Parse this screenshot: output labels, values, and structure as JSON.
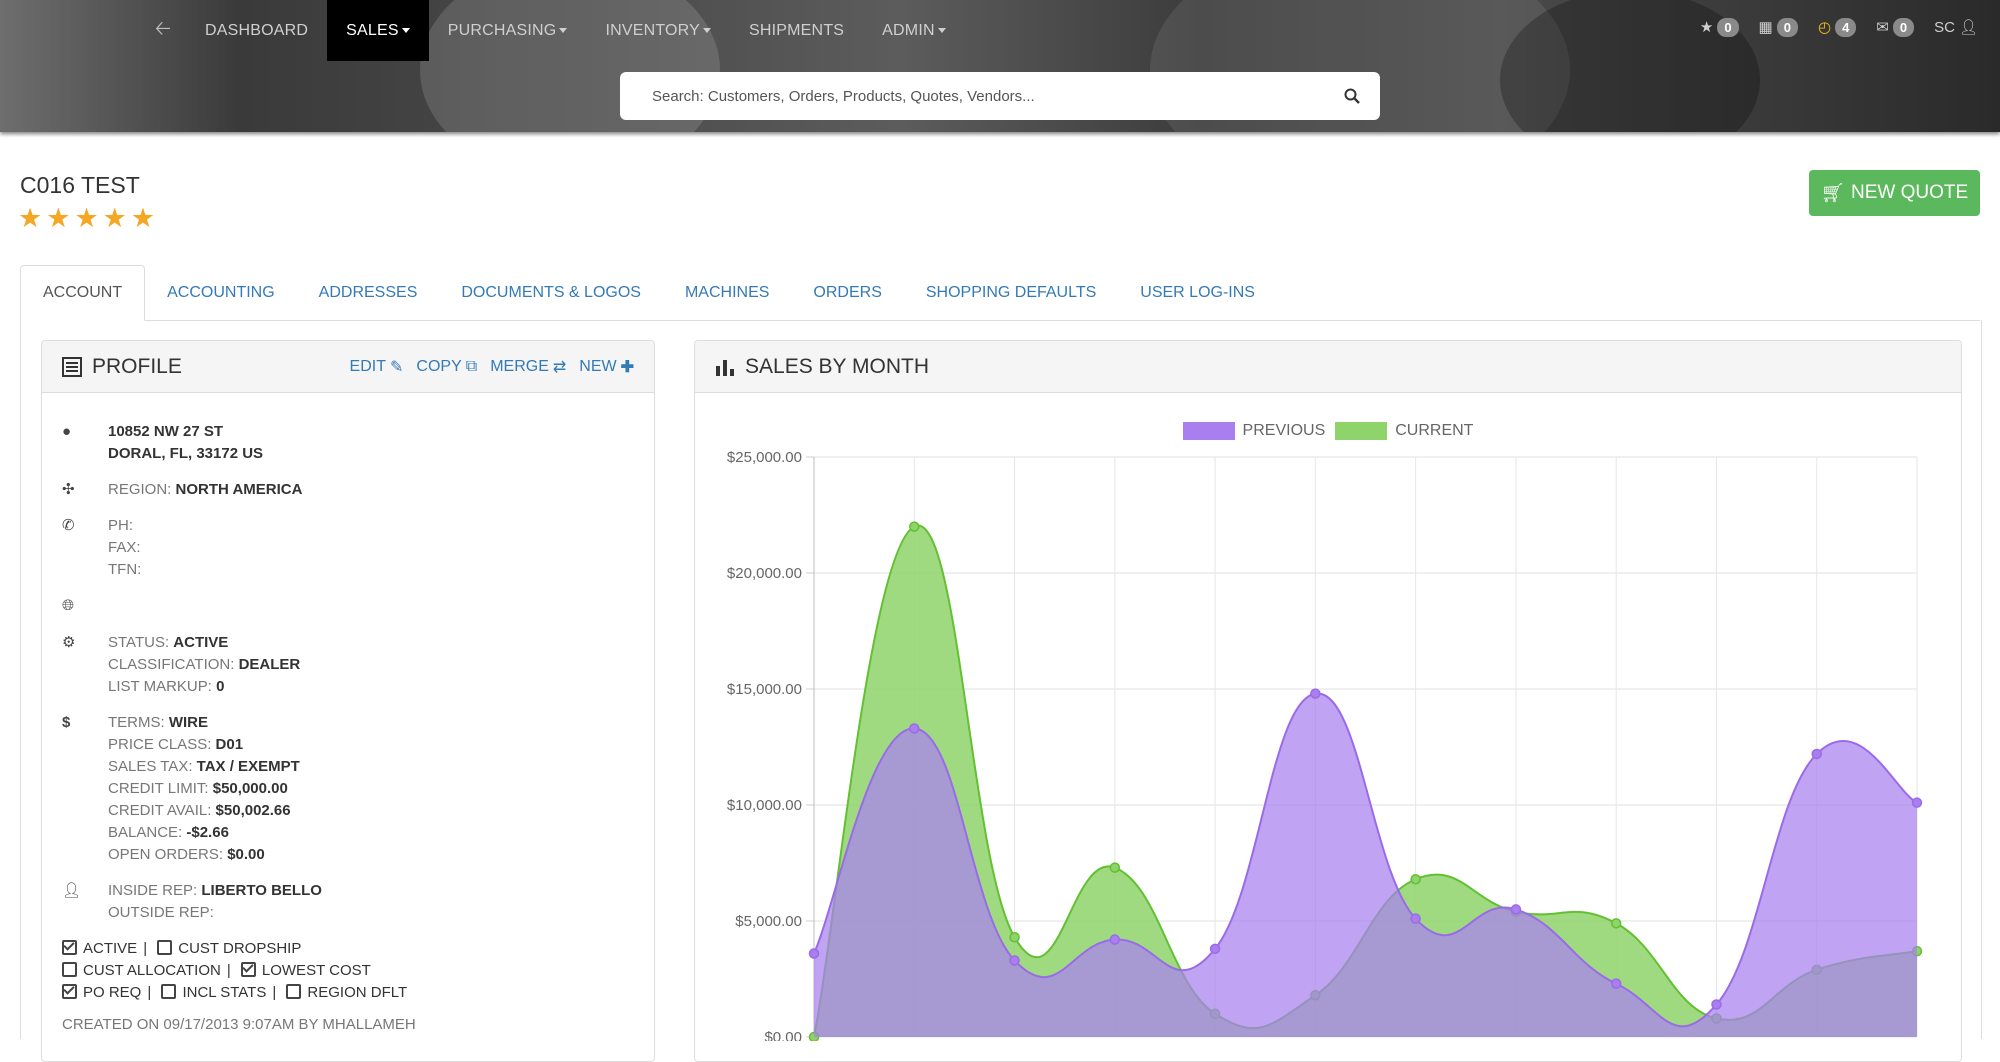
{
  "nav": {
    "items": [
      {
        "label": "DASHBOARD"
      },
      {
        "label": "SALES"
      },
      {
        "label": "PURCHASING"
      },
      {
        "label": "INVENTORY"
      },
      {
        "label": "SHIPMENTS"
      },
      {
        "label": "ADMIN"
      }
    ],
    "active": "SALES",
    "badges": {
      "favorites": "0",
      "calendar": "0",
      "clock": "4",
      "mail": "0"
    },
    "user": "SC"
  },
  "search": {
    "placeholder": "Search: Customers, Orders, Products, Quotes, Vendors..."
  },
  "page": {
    "title": "C016 TEST",
    "rating": 5,
    "new_quote": "NEW QUOTE"
  },
  "tabs": [
    {
      "label": "ACCOUNT"
    },
    {
      "label": "ACCOUNTING"
    },
    {
      "label": "ADDRESSES"
    },
    {
      "label": "DOCUMENTS & LOGOS"
    },
    {
      "label": "MACHINES"
    },
    {
      "label": "ORDERS"
    },
    {
      "label": "SHOPPING DEFAULTS"
    },
    {
      "label": "USER LOG-INS"
    }
  ],
  "profile": {
    "title": "PROFILE",
    "actions": {
      "edit": "EDIT",
      "copy": "COPY",
      "merge": "MERGE",
      "new": "NEW"
    },
    "address1": "10852 NW 27 ST",
    "address2": "DORAL, FL, 33172 US",
    "region_label": "REGION:",
    "region": "NORTH AMERICA",
    "ph_label": "PH:",
    "fax_label": "FAX:",
    "tfn_label": "TFN:",
    "status_label": "STATUS:",
    "status": "ACTIVE",
    "classification_label": "CLASSIFICATION:",
    "classification": "DEALER",
    "list_markup_label": "LIST MARKUP:",
    "list_markup": "0",
    "terms_label": "TERMS:",
    "terms": "WIRE",
    "price_class_label": "PRICE CLASS:",
    "price_class": "D01",
    "sales_tax_label": "SALES TAX:",
    "sales_tax": "TAX / EXEMPT",
    "credit_limit_label": "CREDIT LIMIT:",
    "credit_limit": "$50,000.00",
    "credit_avail_label": "CREDIT AVAIL:",
    "credit_avail": "$50,002.66",
    "balance_label": "BALANCE:",
    "balance": "-$2.66",
    "open_orders_label": "OPEN ORDERS:",
    "open_orders": "$0.00",
    "inside_rep_label": "INSIDE REP:",
    "inside_rep": "LIBERTO BELLO",
    "outside_rep_label": "OUTSIDE REP:",
    "flags": {
      "active": {
        "label": "ACTIVE",
        "checked": true
      },
      "cust_dropship": {
        "label": "CUST DROPSHIP",
        "checked": false
      },
      "cust_allocation": {
        "label": "CUST ALLOCATION",
        "checked": false
      },
      "lowest_cost": {
        "label": "LOWEST COST",
        "checked": true
      },
      "po_req": {
        "label": "PO REQ",
        "checked": true
      },
      "incl_stats": {
        "label": "INCL STATS",
        "checked": false
      },
      "region_dflt": {
        "label": "REGION DFLT",
        "checked": false
      }
    },
    "created": "CREATED ON 09/17/2013 9:07AM BY MHALLAMEH"
  },
  "sales_panel": {
    "title": "SALES BY MONTH"
  },
  "chart_data": {
    "type": "area",
    "ylim": [
      0,
      25000
    ],
    "y_ticks": [
      "$0.00",
      "$5,000.00",
      "$10,000.00",
      "$15,000.00",
      "$20,000.00",
      "$25,000.00"
    ],
    "legend_position": "top-center",
    "grid": true,
    "series": [
      {
        "name": "PREVIOUS",
        "color": "#a97ff0",
        "values": [
          3600,
          13300,
          3300,
          4200,
          3800,
          14800,
          5100,
          5500,
          2300,
          1400,
          12200,
          10100
        ]
      },
      {
        "name": "CURRENT",
        "color": "#8fd46a",
        "values": [
          0,
          22000,
          4300,
          7300,
          1000,
          1800,
          6800,
          5400,
          4900,
          800,
          2900,
          3700
        ]
      }
    ]
  }
}
